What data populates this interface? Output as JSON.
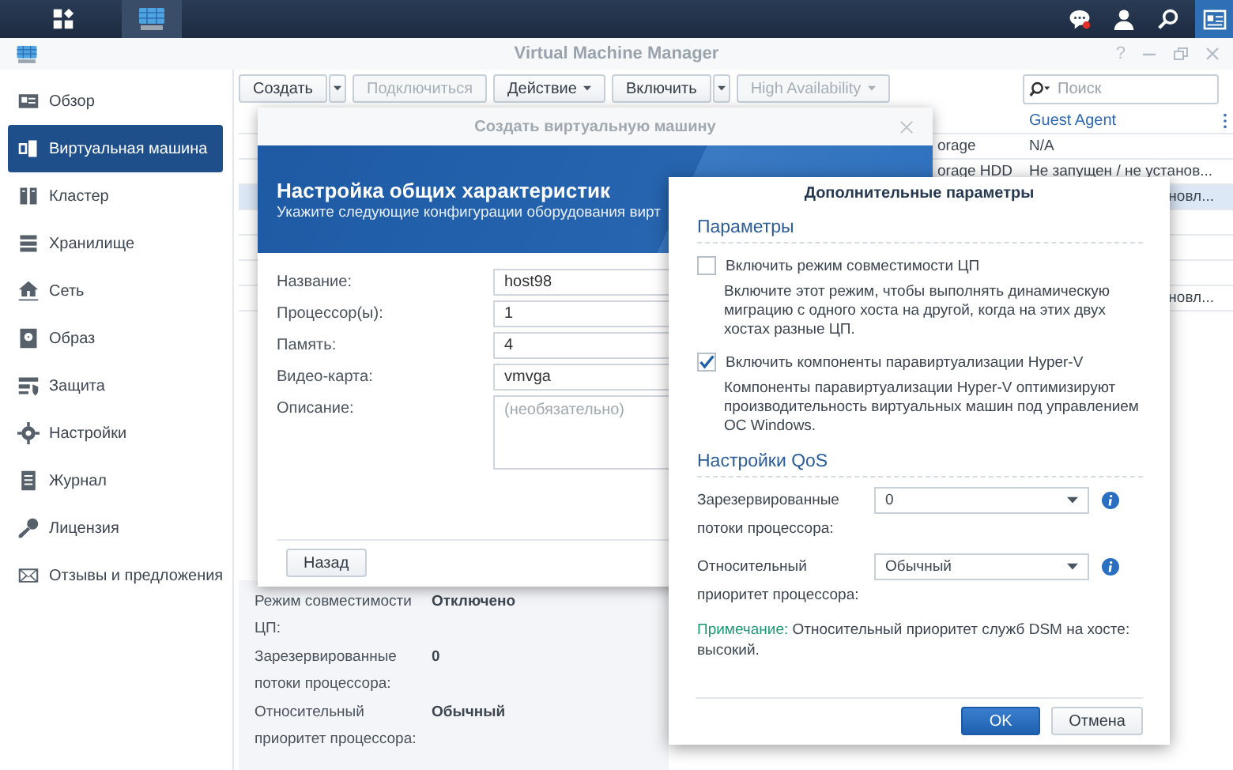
{
  "window": {
    "title": "Virtual Machine Manager",
    "help": "?"
  },
  "sidebar": {
    "items": [
      {
        "label": "Обзор",
        "selected": false
      },
      {
        "label": "Виртуальная машина",
        "selected": true
      },
      {
        "label": "Кластер",
        "selected": false
      },
      {
        "label": "Хранилище",
        "selected": false
      },
      {
        "label": "Сеть",
        "selected": false
      },
      {
        "label": "Образ",
        "selected": false
      },
      {
        "label": "Защита",
        "selected": false
      },
      {
        "label": "Настройки",
        "selected": false
      },
      {
        "label": "Журнал",
        "selected": false
      },
      {
        "label": "Лицензия",
        "selected": false
      },
      {
        "label": "Отзывы и предложения",
        "selected": false
      }
    ]
  },
  "toolbar": {
    "buttons": [
      {
        "label": "Создать",
        "kind": "split",
        "disabled": false
      },
      {
        "label": "Подключиться",
        "kind": "plain",
        "disabled": true
      },
      {
        "label": "Действие",
        "kind": "menu",
        "disabled": false
      },
      {
        "label": "Включить",
        "kind": "split",
        "disabled": false
      },
      {
        "label": "High Availability",
        "kind": "menu",
        "disabled": true
      }
    ],
    "search": {
      "placeholder": "Поиск"
    }
  },
  "table": {
    "header": "Guest Agent",
    "rows": [
      {
        "column_1": "orage",
        "guest_agent": "N/A",
        "selected": false
      },
      {
        "column_1": "orage HDD",
        "guest_agent": "Не запущен / не установ...",
        "selected": false
      },
      {
        "guest_agent_tail": "новл...",
        "selected": true
      },
      {
        "selected": false
      },
      {
        "selected": false
      },
      {
        "selected": false
      },
      {
        "guest_agent_tail": "новл...",
        "selected": false
      }
    ]
  },
  "details": [
    {
      "label": "Режим совместимости ЦП:",
      "value": "Отключено"
    },
    {
      "label": "Зарезервированные потоки процессора:",
      "value": "0"
    },
    {
      "label": "Относительный приоритет процессора:",
      "value": "Обычный"
    }
  ],
  "wizard": {
    "title": "Создать виртуальную машину",
    "heading": "Настройка общих характеристик",
    "subheading": "Укажите следующие конфигурации оборудования вирт",
    "fields": [
      {
        "label": "Название:",
        "value": "host98",
        "kind": "input"
      },
      {
        "label": "Процессор(ы):",
        "value": "1",
        "kind": "input"
      },
      {
        "label": "Память:",
        "value": "4",
        "kind": "input"
      },
      {
        "label": "Видео-карта:",
        "value": "vmvga",
        "kind": "input"
      },
      {
        "label": "Описание:",
        "placeholder": "(необязательно)",
        "kind": "textarea"
      }
    ],
    "back_button": "Назад"
  },
  "advanced": {
    "title": "Дополнительные параметры",
    "params_title": "Параметры",
    "options": [
      {
        "label": "Включить режим совместимости ЦП",
        "checked": false,
        "description": "Включите этот режим, чтобы выполнять динамическую миграцию с одного хоста на другой, когда на этих двух хостах разные ЦП."
      },
      {
        "label": "Включить компоненты паравиртуализации Hyper-V",
        "checked": true,
        "description": "Компоненты паравиртуализации Hyper-V оптимизируют производительность виртуальных машин под управлением ОС Windows."
      }
    ],
    "qos_title": "Настройки QoS",
    "qos_fields": [
      {
        "label": "Зарезервированные потоки процессора:",
        "value": "0"
      },
      {
        "label": "Относительный приоритет процессора:",
        "value": "Обычный"
      }
    ],
    "note": {
      "prefix": "Примечание:",
      "text": "Относительный приоритет служб DSM на хосте: высокий."
    },
    "ok": "OK",
    "cancel": "Отмена"
  }
}
